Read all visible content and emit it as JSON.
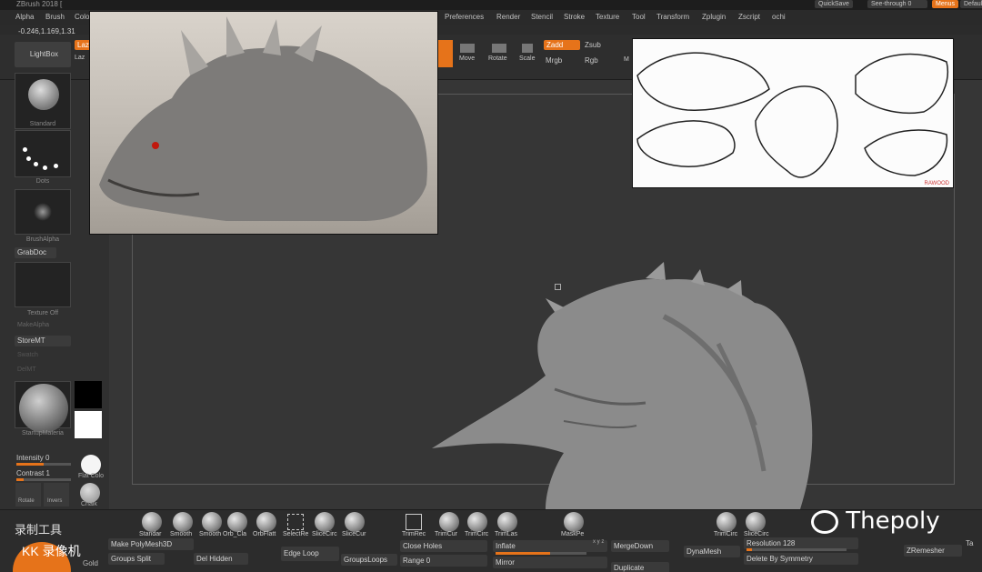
{
  "app": {
    "title": "ZBrush 2018 [",
    "quicksave": "QuickSave",
    "see_through": "See-through 0",
    "menus": "Menus",
    "default": "Default"
  },
  "menubar": {
    "left": [
      "Alpha",
      "Brush",
      "Colo"
    ],
    "right": [
      "Preferences",
      "Render",
      "Stencil",
      "Stroke",
      "Texture",
      "Tool",
      "Transform",
      "Zplugin",
      "Zscript",
      "ochi"
    ]
  },
  "coords": "-0.246,1.169,1.31",
  "shelf": {
    "lightbox": "LightBox",
    "laz1": "Laz",
    "laz2": "Laz",
    "move": "Move",
    "rotate": "Rotate",
    "scale": "Scale",
    "zadd": "Zadd",
    "zsub": "Zsub",
    "mrgb": "Mrgb",
    "rgb": "Rgb",
    "m": "M"
  },
  "left_panel": {
    "thumb1": "Standard",
    "thumb2": "Dots",
    "thumb3": "BrushAlpha",
    "grabdoc": "GrabDoc",
    "thumb4": "Texture Off",
    "makealpha": "MakeAlpha",
    "storemt": "StoreMT",
    "swatch": "Swatch",
    "delmt": "DelMT",
    "material": "StartupMateria",
    "intensity": "Intensity 0",
    "contrast": "Contrast 1",
    "flat_color": "Flat Colo",
    "rotate": "Rotate",
    "invert": "Invers",
    "chalk": "Chalk",
    "gold": "Gold",
    "rec1": "录制工具",
    "rec2": "KK 录像机"
  },
  "brushes": [
    "Standar",
    "Smooth",
    "Smooth",
    "Orb_Cla",
    "OrbFlatt",
    "SelectRe",
    "SliceCirc",
    "SliceCur",
    "TrimRec",
    "TrimCur",
    "TrimCirc",
    "TrimLas",
    "MaskPe",
    "TrimCirc",
    "SliceCirc"
  ],
  "bottom": {
    "make_polymesh": "Make PolyMesh3D",
    "groups_split": "Groups Split",
    "del_hidden": "Del Hidden",
    "edge_loop": "Edge Loop",
    "groups_loops": "GroupsLoops",
    "close_holes": "Close Holes",
    "range": "Range 0",
    "inflate": "Inflate",
    "mirror": "Mirror",
    "merge_down": "MergeDown",
    "duplicate": "Duplicate",
    "dynamesh": "DynaMesh",
    "resolution": "Resolution 128",
    "delete_sym": "Delete By Symmetry",
    "zremesher": "ZRemesher",
    "xyz": "x y z",
    "ta": "Ta"
  },
  "watermark": "Thepoly",
  "ref_right_brand": "RAWOOD",
  "inflate_level": 0.6,
  "resolution_level": 0.05
}
